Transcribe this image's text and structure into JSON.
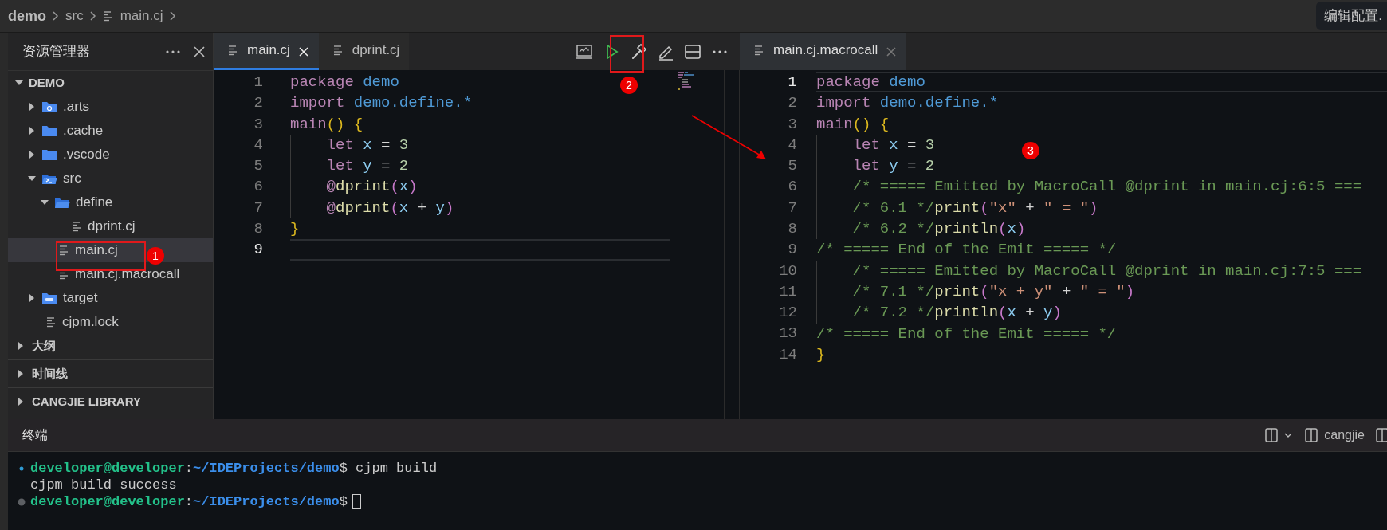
{
  "breadcrumbs": [
    {
      "label": "demo",
      "kind": "root"
    },
    {
      "label": "src",
      "kind": "folder"
    },
    {
      "label": "main.cj",
      "kind": "file"
    }
  ],
  "edit_config_button": "编辑配置.",
  "explorer": {
    "title": "资源管理器",
    "tree": [
      {
        "label": "DEMO",
        "kind": "root",
        "expanded": true,
        "selected": false,
        "children": [
          {
            "label": ".arts",
            "kind": "folder-gear",
            "expanded": false,
            "selected": false
          },
          {
            "label": ".cache",
            "kind": "folder",
            "expanded": false,
            "selected": false
          },
          {
            "label": ".vscode",
            "kind": "folder",
            "expanded": false,
            "selected": false
          },
          {
            "label": "src",
            "kind": "folder-code",
            "expanded": true,
            "selected": false,
            "children": [
              {
                "label": "define",
                "kind": "folder",
                "expanded": true,
                "selected": false,
                "children": [
                  {
                    "label": "dprint.cj",
                    "kind": "file",
                    "selected": false
                  }
                ]
              },
              {
                "label": "main.cj",
                "kind": "file",
                "selected": true
              },
              {
                "label": "main.cj.macrocall",
                "kind": "file",
                "selected": false
              }
            ]
          },
          {
            "label": "target",
            "kind": "folder-badge",
            "expanded": false,
            "selected": false
          },
          {
            "label": "cjpm.lock",
            "kind": "file",
            "selected": false
          }
        ]
      }
    ],
    "sections": [
      {
        "label": "大纲",
        "expanded": false
      },
      {
        "label": "时间线",
        "expanded": false
      },
      {
        "label": "CANGJIE LIBRARY",
        "expanded": false
      }
    ]
  },
  "editor_left": {
    "focused": true,
    "tabs": [
      {
        "label": "main.cj",
        "selected": true
      },
      {
        "label": "dprint.cj",
        "selected": false
      }
    ],
    "lines": [
      {
        "n": "1",
        "current": false,
        "tokens": [
          {
            "text": "package ",
            "kind": "keyword"
          },
          {
            "text": "demo",
            "kind": "namespace"
          }
        ]
      },
      {
        "n": "2",
        "current": false,
        "tokens": [
          {
            "text": "import ",
            "kind": "keyword"
          },
          {
            "text": "demo.define.*",
            "kind": "namespace"
          }
        ]
      },
      {
        "n": "3",
        "current": false,
        "tokens": [
          {
            "text": "main",
            "kind": "keyword"
          },
          {
            "text": "() {",
            "kind": "brace"
          }
        ]
      },
      {
        "n": "4",
        "current": false,
        "tokens": [
          {
            "text": "    let ",
            "kind": "keyword"
          },
          {
            "text": "x",
            "kind": "variable"
          },
          {
            "text": " = ",
            "kind": "plain"
          },
          {
            "text": "3",
            "kind": "number"
          }
        ]
      },
      {
        "n": "5",
        "current": false,
        "tokens": [
          {
            "text": "    let ",
            "kind": "keyword"
          },
          {
            "text": "y",
            "kind": "variable"
          },
          {
            "text": " = ",
            "kind": "plain"
          },
          {
            "text": "2",
            "kind": "number"
          }
        ]
      },
      {
        "n": "6",
        "current": false,
        "tokens": [
          {
            "text": "    @",
            "kind": "keyword"
          },
          {
            "text": "dprint",
            "kind": "function"
          },
          {
            "text": "(",
            "kind": "paren"
          },
          {
            "text": "x",
            "kind": "variable"
          },
          {
            "text": ")",
            "kind": "paren"
          }
        ]
      },
      {
        "n": "7",
        "current": false,
        "tokens": [
          {
            "text": "    @",
            "kind": "keyword"
          },
          {
            "text": "dprint",
            "kind": "function"
          },
          {
            "text": "(",
            "kind": "paren"
          },
          {
            "text": "x",
            "kind": "variable"
          },
          {
            "text": " + ",
            "kind": "plain"
          },
          {
            "text": "y",
            "kind": "variable"
          },
          {
            "text": ")",
            "kind": "paren"
          }
        ]
      },
      {
        "n": "8",
        "current": false,
        "tokens": [
          {
            "text": "}",
            "kind": "brace"
          }
        ]
      },
      {
        "n": "9",
        "current": true
      }
    ]
  },
  "editor_right": {
    "focused": false,
    "tabs": [
      {
        "label": "main.cj.macrocall",
        "selected": true
      }
    ],
    "lines": [
      {
        "n": "1",
        "current": true,
        "tokens": [
          {
            "text": "package ",
            "kind": "keyword"
          },
          {
            "text": "demo",
            "kind": "namespace"
          }
        ]
      },
      {
        "n": "2",
        "current": false,
        "tokens": [
          {
            "text": "import ",
            "kind": "keyword"
          },
          {
            "text": "demo.define.*",
            "kind": "namespace"
          }
        ]
      },
      {
        "n": "3",
        "current": false,
        "tokens": [
          {
            "text": "main",
            "kind": "keyword"
          },
          {
            "text": "() {",
            "kind": "brace"
          }
        ]
      },
      {
        "n": "4",
        "current": false,
        "tokens": [
          {
            "text": "    let ",
            "kind": "keyword"
          },
          {
            "text": "x",
            "kind": "variable"
          },
          {
            "text": " = ",
            "kind": "plain"
          },
          {
            "text": "3",
            "kind": "number"
          }
        ]
      },
      {
        "n": "5",
        "current": false,
        "tokens": [
          {
            "text": "    let ",
            "kind": "keyword"
          },
          {
            "text": "y",
            "kind": "variable"
          },
          {
            "text": " = ",
            "kind": "plain"
          },
          {
            "text": "2",
            "kind": "number"
          }
        ]
      },
      {
        "n": "6",
        "current": false,
        "tokens": [
          {
            "text": "    /* ===== Emitted by MacroCall @dprint in main.cj:6:5 ===",
            "kind": "comment"
          }
        ]
      },
      {
        "n": "7",
        "current": false,
        "tokens": [
          {
            "text": "    /* 6.1 */",
            "kind": "comment"
          },
          {
            "text": "print",
            "kind": "function"
          },
          {
            "text": "(",
            "kind": "paren"
          },
          {
            "text": "\"x\"",
            "kind": "string"
          },
          {
            "text": " + ",
            "kind": "plain"
          },
          {
            "text": "\" = \"",
            "kind": "string"
          },
          {
            "text": ")",
            "kind": "paren"
          }
        ]
      },
      {
        "n": "8",
        "current": false,
        "tokens": [
          {
            "text": "    /* 6.2 */",
            "kind": "comment"
          },
          {
            "text": "println",
            "kind": "function"
          },
          {
            "text": "(",
            "kind": "paren"
          },
          {
            "text": "x",
            "kind": "variable"
          },
          {
            "text": ")",
            "kind": "paren"
          }
        ]
      },
      {
        "n": "9",
        "current": false,
        "tokens": [
          {
            "text": "/* ===== End of the Emit ===== */",
            "kind": "comment"
          }
        ]
      },
      {
        "n": "10",
        "current": false,
        "tokens": [
          {
            "text": "    /* ===== Emitted by MacroCall @dprint in main.cj:7:5 ===",
            "kind": "comment"
          }
        ]
      },
      {
        "n": "11",
        "current": false,
        "tokens": [
          {
            "text": "    /* 7.1 */",
            "kind": "comment"
          },
          {
            "text": "print",
            "kind": "function"
          },
          {
            "text": "(",
            "kind": "paren"
          },
          {
            "text": "\"x + y\"",
            "kind": "string"
          },
          {
            "text": " + ",
            "kind": "plain"
          },
          {
            "text": "\" = \"",
            "kind": "string"
          },
          {
            "text": ")",
            "kind": "paren"
          }
        ]
      },
      {
        "n": "12",
        "current": false,
        "tokens": [
          {
            "text": "    /* 7.2 */",
            "kind": "comment"
          },
          {
            "text": "println",
            "kind": "function"
          },
          {
            "text": "(",
            "kind": "paren"
          },
          {
            "text": "x",
            "kind": "variable"
          },
          {
            "text": " + ",
            "kind": "plain"
          },
          {
            "text": "y",
            "kind": "variable"
          },
          {
            "text": ")",
            "kind": "paren"
          }
        ]
      },
      {
        "n": "13",
        "current": false,
        "tokens": [
          {
            "text": "/* ===== End of the Emit ===== */",
            "kind": "comment"
          }
        ]
      },
      {
        "n": "14",
        "current": false,
        "tokens": [
          {
            "text": "}",
            "kind": "brace"
          }
        ]
      }
    ]
  },
  "terminal": {
    "title": "终端",
    "profile": "cangjie",
    "lines": [
      {
        "kind": "prompt",
        "color": "#2f9bd3",
        "user": "developer@developer",
        "sep": ":",
        "path": "~/IDEProjects/demo",
        "symbol": "$",
        "command": " cjpm build",
        "cursor": false
      },
      {
        "kind": "output",
        "text": "cjpm build success"
      },
      {
        "kind": "prompt",
        "color": "#5c5f63",
        "user": "developer@developer",
        "sep": ":",
        "path": "~/IDEProjects/demo",
        "symbol": "$",
        "cursor": true
      }
    ]
  },
  "annotations": [
    {
      "label": "1"
    },
    {
      "label": "2"
    },
    {
      "label": "3"
    }
  ]
}
